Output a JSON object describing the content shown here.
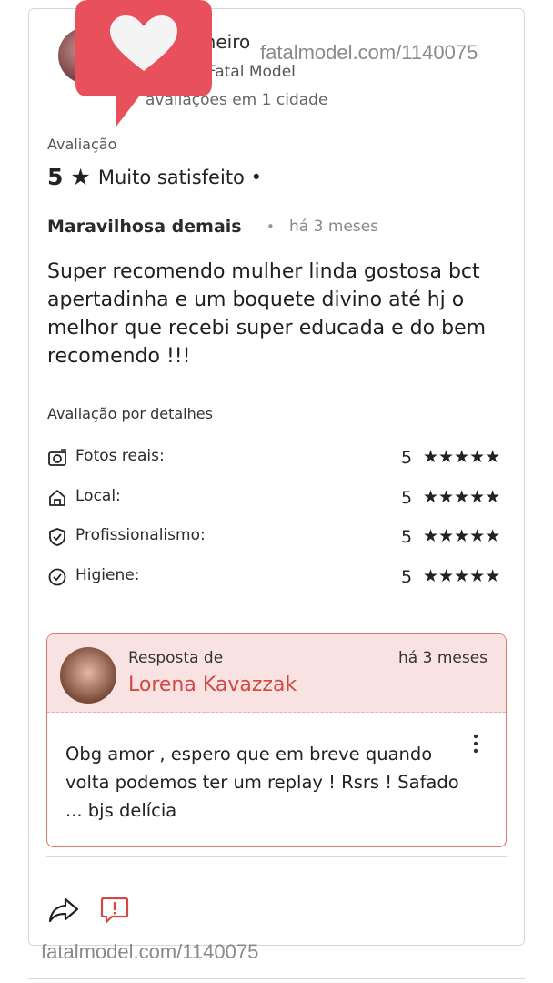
{
  "header": {
    "user_name": "nheiro",
    "user_sub": "Fatal Model",
    "user_count": "avaliações em 1 cidade",
    "watermark": "fatalmodel.com/1140075"
  },
  "rating": {
    "label": "Avaliação",
    "score": "5",
    "star": "★",
    "text": "Muito satisfeito •"
  },
  "review": {
    "title": "Maravilhosa demais",
    "dot": "•",
    "time": "há 3 meses",
    "body": "Super recomendo mulher linda gostosa bct apertadinha e um boquete divino até hj o melhor que recebi super educada e do bem recomendo !!!"
  },
  "details": {
    "label": "Avaliação por detalhes",
    "rows": [
      {
        "icon": "camera-icon",
        "label": "Fotos reais:",
        "score": "5",
        "stars": "★★★★★",
        "value": 5
      },
      {
        "icon": "home-icon",
        "label": "Local:",
        "score": "5",
        "stars": "★★★★★",
        "value": 5
      },
      {
        "icon": "shield-check-icon",
        "label": "Profissionalismo:",
        "score": "5",
        "stars": "★★★★★",
        "value": 5
      },
      {
        "icon": "check-circle-icon",
        "label": "Higiene:",
        "score": "5",
        "stars": "★★★★★",
        "value": 5
      }
    ]
  },
  "reply": {
    "label": "Resposta de",
    "name": "Lorena Kavazzak",
    "time": "há 3 meses",
    "body": "Obg amor , espero que em breve quando volta podemos ter um replay ! Rsrs ! Safado ... bjs delícia"
  },
  "footer": {
    "watermark": "fatalmodel.com/1140075",
    "icons": [
      "share-icon",
      "report-icon"
    ]
  },
  "colors": {
    "accent": "#d04a43",
    "reply_bg": "#f9e3e2",
    "reply_border": "#d97a72",
    "heart_badge": "#e8505b"
  }
}
